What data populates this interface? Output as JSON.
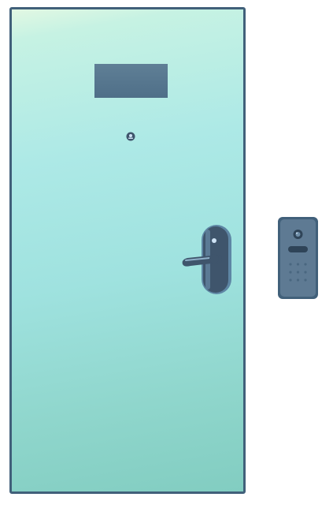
{
  "scene": {
    "colors": {
      "door_frame": "#41607a",
      "door_top": "#e2f8e3",
      "door_bottom": "#82cdc1",
      "window": "#56768f",
      "hardware": "#3f556c",
      "hardware_highlight": "#cfe3f5"
    },
    "icons": {
      "peephole": "peephole-icon",
      "handle": "door-handle-icon",
      "keypad": "keypad-icon"
    }
  }
}
